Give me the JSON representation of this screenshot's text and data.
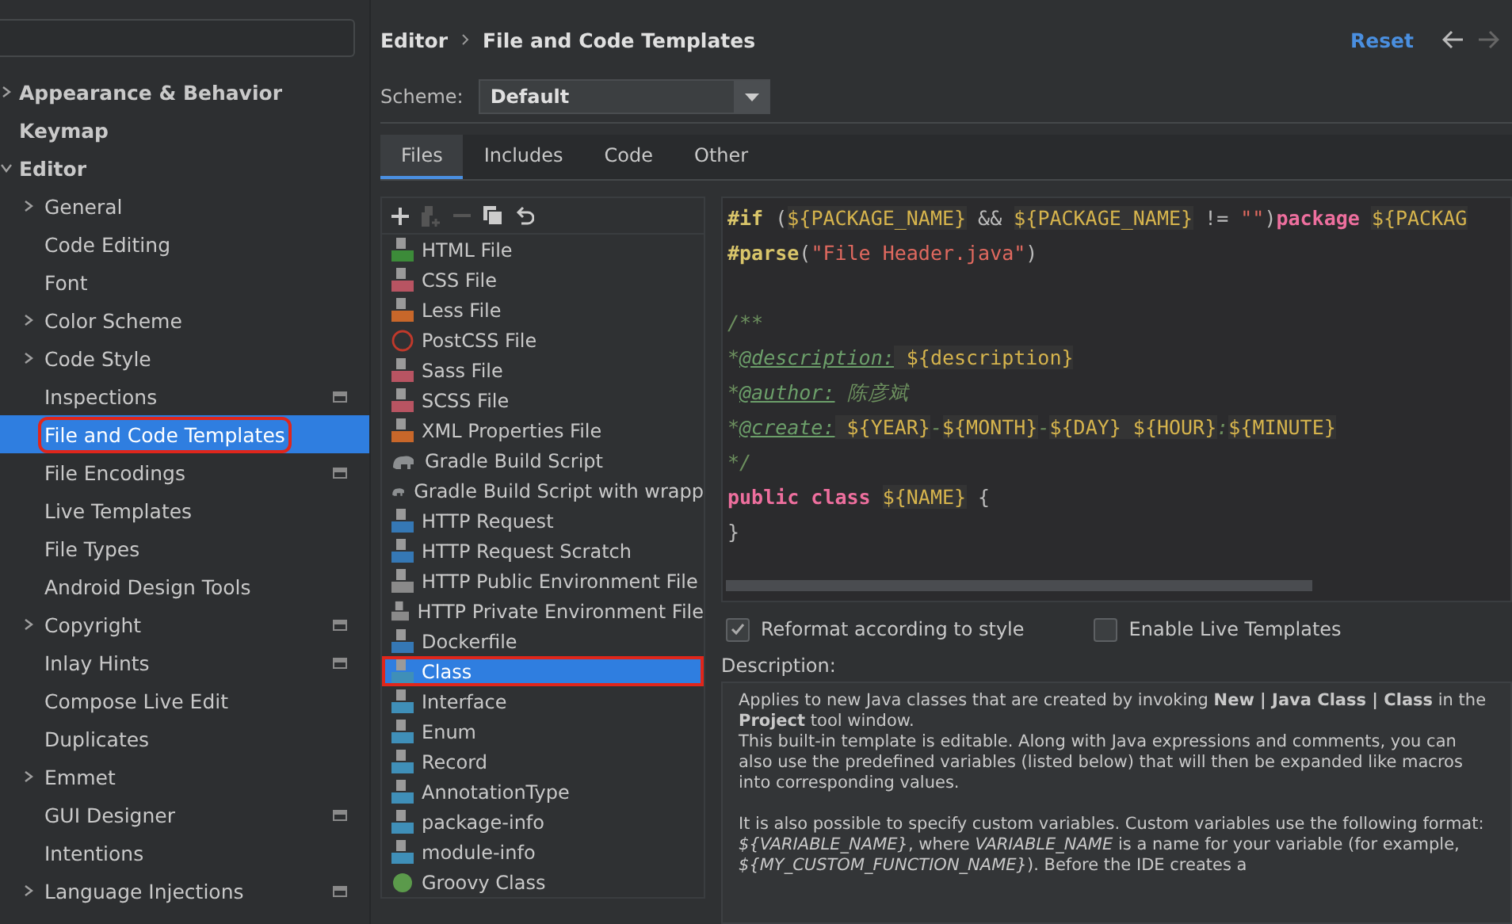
{
  "sidebar": {
    "items": [
      {
        "label": "Appearance & Behavior",
        "expanded": false,
        "expandable": true,
        "selected": false
      },
      {
        "label": "Keymap",
        "expandable": false,
        "selected": false
      },
      {
        "label": "Editor",
        "expanded": true,
        "expandable": true,
        "selected": false,
        "children": [
          {
            "label": "General",
            "expandable": true,
            "selected": false
          },
          {
            "label": "Code Editing",
            "selected": false
          },
          {
            "label": "Font",
            "selected": false
          },
          {
            "label": "Color Scheme",
            "expandable": true,
            "selected": false
          },
          {
            "label": "Code Style",
            "expandable": true,
            "selected": false
          },
          {
            "label": "Inspections",
            "project": true,
            "selected": false
          },
          {
            "label": "File and Code Templates",
            "selected": true,
            "annotated": true
          },
          {
            "label": "File Encodings",
            "project": true,
            "selected": false
          },
          {
            "label": "Live Templates",
            "selected": false
          },
          {
            "label": "File Types",
            "selected": false
          },
          {
            "label": "Android Design Tools",
            "selected": false
          },
          {
            "label": "Copyright",
            "expandable": true,
            "project": true,
            "selected": false
          },
          {
            "label": "Inlay Hints",
            "project": true,
            "selected": false
          },
          {
            "label": "Compose Live Edit",
            "selected": false
          },
          {
            "label": "Duplicates",
            "selected": false
          },
          {
            "label": "Emmet",
            "expandable": true,
            "selected": false
          },
          {
            "label": "GUI Designer",
            "project": true,
            "selected": false
          },
          {
            "label": "Intentions",
            "selected": false
          },
          {
            "label": "Language Injections",
            "expandable": true,
            "project": true,
            "selected": false
          }
        ]
      }
    ]
  },
  "breadcrumb": [
    "Editor",
    "File and Code Templates"
  ],
  "reset": "Reset",
  "scheme": {
    "label": "Scheme:",
    "value": "Default"
  },
  "tabs": [
    {
      "label": "Files",
      "selected": true
    },
    {
      "label": "Includes",
      "selected": false
    },
    {
      "label": "Code",
      "selected": false
    },
    {
      "label": "Other",
      "selected": false
    }
  ],
  "templates": [
    {
      "label": "HTML File",
      "kind": "html",
      "selected": false
    },
    {
      "label": "CSS File",
      "kind": "css",
      "selected": false
    },
    {
      "label": "Less File",
      "kind": "less",
      "selected": false
    },
    {
      "label": "PostCSS File",
      "kind": "postcss",
      "selected": false
    },
    {
      "label": "Sass File",
      "kind": "sass",
      "selected": false
    },
    {
      "label": "SCSS File",
      "kind": "sass",
      "selected": false
    },
    {
      "label": "XML Properties File",
      "kind": "xml",
      "selected": false
    },
    {
      "label": "Gradle Build Script",
      "kind": "gradle",
      "selected": false
    },
    {
      "label": "Gradle Build Script with wrapp",
      "kind": "gradle",
      "selected": false
    },
    {
      "label": "HTTP Request",
      "kind": "api",
      "selected": false
    },
    {
      "label": "HTTP Request Scratch",
      "kind": "api",
      "selected": false
    },
    {
      "label": "HTTP Public Environment File",
      "kind": "env",
      "selected": false
    },
    {
      "label": "HTTP Private Environment File",
      "kind": "env",
      "selected": false
    },
    {
      "label": "Dockerfile",
      "kind": "docker",
      "selected": false
    },
    {
      "label": "Class",
      "kind": "java",
      "selected": true,
      "annotated": true
    },
    {
      "label": "Interface",
      "kind": "java",
      "selected": false
    },
    {
      "label": "Enum",
      "kind": "java",
      "selected": false
    },
    {
      "label": "Record",
      "kind": "java",
      "selected": false
    },
    {
      "label": "AnnotationType",
      "kind": "java",
      "selected": false
    },
    {
      "label": "package-info",
      "kind": "java",
      "selected": false
    },
    {
      "label": "module-info",
      "kind": "java",
      "selected": false
    },
    {
      "label": "Groovy Class",
      "kind": "groovy",
      "selected": false
    }
  ],
  "code": [
    {
      "tokens": [
        {
          "kind": "directive",
          "text": "#if"
        },
        {
          "kind": "plain",
          "text": " ("
        },
        {
          "kind": "var",
          "text": "${PACKAGE_NAME}"
        },
        {
          "kind": "plain",
          "text": " && "
        },
        {
          "kind": "var",
          "text": "${PACKAGE_NAME}"
        },
        {
          "kind": "plain",
          "text": " != "
        },
        {
          "kind": "string",
          "text": "\"\""
        },
        {
          "kind": "plain",
          "text": ")"
        },
        {
          "kind": "keyword",
          "text": "package "
        },
        {
          "kind": "var",
          "text": "${PACKAG"
        }
      ]
    },
    {
      "tokens": [
        {
          "kind": "directive",
          "text": "#parse"
        },
        {
          "kind": "plain",
          "text": "("
        },
        {
          "kind": "string",
          "text": "\"File Header.java\""
        },
        {
          "kind": "plain",
          "text": ")"
        }
      ]
    },
    {
      "blank_before": true,
      "tokens": [
        {
          "kind": "comment",
          "text": "/**"
        }
      ]
    },
    {
      "tokens": [
        {
          "kind": "comment",
          "text": "*"
        },
        {
          "kind": "doctag",
          "text": "@description:"
        },
        {
          "kind": "var",
          "text": " ${description}"
        }
      ]
    },
    {
      "tokens": [
        {
          "kind": "comment",
          "text": "*"
        },
        {
          "kind": "doctag",
          "text": "@author:"
        },
        {
          "kind": "comment",
          "text": " 陈彦斌"
        }
      ]
    },
    {
      "tokens": [
        {
          "kind": "comment",
          "text": "*"
        },
        {
          "kind": "doctag",
          "text": "@create:"
        },
        {
          "kind": "var",
          "text": " ${YEAR}"
        },
        {
          "kind": "comment",
          "text": "-"
        },
        {
          "kind": "var",
          "text": "${MONTH}"
        },
        {
          "kind": "comment",
          "text": "-"
        },
        {
          "kind": "var",
          "text": "${DAY}"
        },
        {
          "kind": "var",
          "text": " ${HOUR}"
        },
        {
          "kind": "comment",
          "text": ":"
        },
        {
          "kind": "var",
          "text": "${MINUTE}"
        }
      ]
    },
    {
      "tokens": [
        {
          "kind": "comment",
          "text": "*/"
        }
      ]
    },
    {
      "tokens": [
        {
          "kind": "keyword",
          "text": "public class "
        },
        {
          "kind": "var",
          "text": "${NAME}"
        },
        {
          "kind": "plain",
          "text": " {"
        }
      ]
    },
    {
      "tokens": [
        {
          "kind": "plain",
          "text": "}"
        }
      ]
    }
  ],
  "options": [
    {
      "label": "Reformat according to style",
      "checked": true
    },
    {
      "label": "Enable Live Templates",
      "checked": false
    }
  ],
  "description_label": "Description:",
  "description": [
    "Applies to new Java classes that are created by invoking **New | Java Class | Class** in the **Project** tool window.",
    "This built-in template is editable. Along with Java expressions and comments, you can also use the predefined variables (listed below) that will then be expanded like macros into corresponding values.",
    "It is also possible to specify custom variables. Custom variables use the following format: *${VARIABLE_NAME}*, where *VARIABLE_NAME* is a name for your variable (for example, *${MY_CUSTOM_FUNCTION_NAME}*). Before the IDE creates a"
  ]
}
